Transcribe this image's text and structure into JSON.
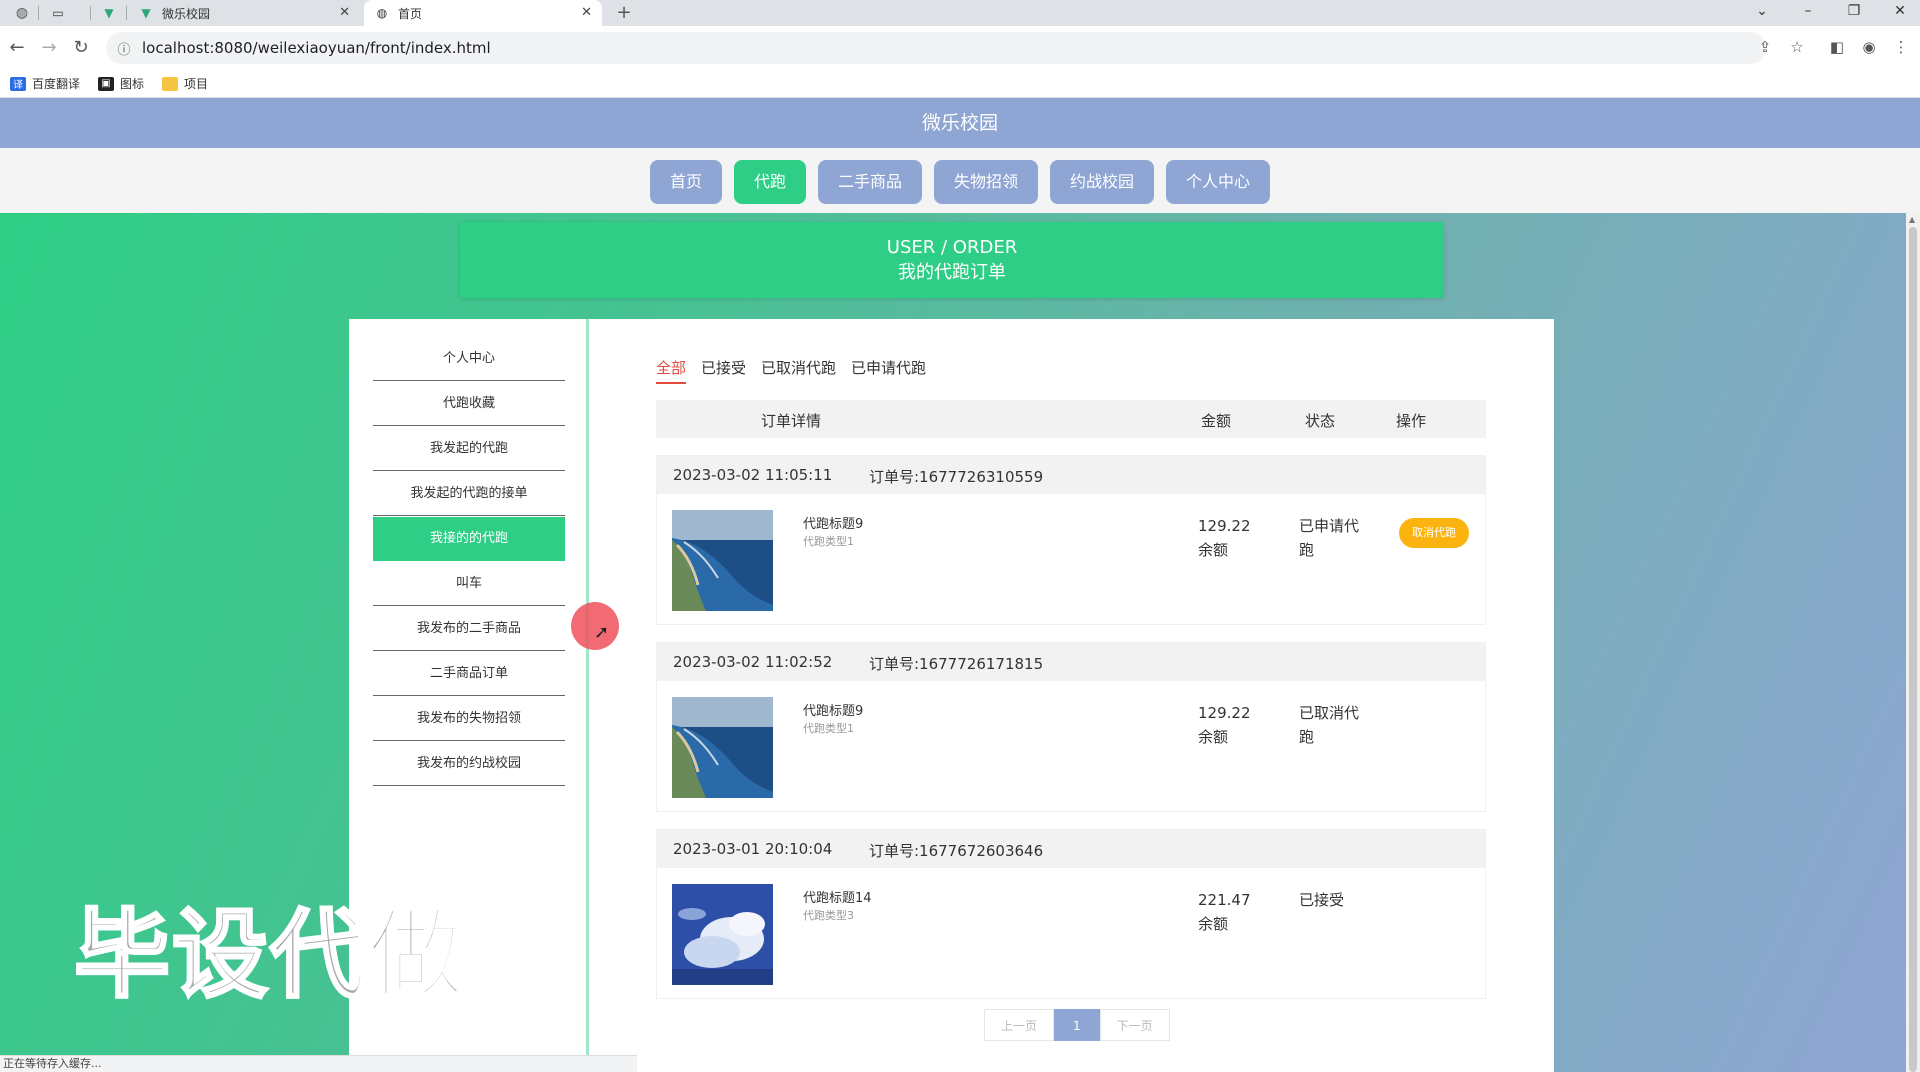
{
  "browser": {
    "tabs": [
      {
        "label": ""
      },
      {
        "label": ""
      },
      {
        "label": "微乐校园"
      },
      {
        "label": "首页"
      }
    ],
    "new_tab_icon": "+",
    "url": "localhost:8080/weilexiaoyuan/front/index.html",
    "bookmarks": [
      {
        "label": "百度翻译",
        "color": "#2b6de5"
      },
      {
        "label": "图标",
        "color": "#222222"
      },
      {
        "label": "项目",
        "color": "#f5c542"
      }
    ],
    "status_text": "正在等待存入缓存..."
  },
  "site": {
    "title": "微乐校园",
    "nav": [
      {
        "label": "首页",
        "active": false
      },
      {
        "label": "代跑",
        "active": true
      },
      {
        "label": "二手商品",
        "active": false
      },
      {
        "label": "失物招领",
        "active": false
      },
      {
        "label": "约战校园",
        "active": false
      },
      {
        "label": "个人中心",
        "active": false
      }
    ],
    "banner": {
      "en": "USER / ORDER",
      "cn": "我的代跑订单"
    },
    "accent_color": "#2ece86",
    "secondary_color": "#8fa5d3"
  },
  "sidebar": {
    "items": [
      {
        "label": "个人中心"
      },
      {
        "label": "代跑收藏"
      },
      {
        "label": "我发起的代跑"
      },
      {
        "label": "我发起的代跑的接单"
      },
      {
        "label": "我接的的代跑",
        "active": true
      },
      {
        "label": "叫车"
      },
      {
        "label": "我发布的二手商品"
      },
      {
        "label": "二手商品订单"
      },
      {
        "label": "我发布的失物招领"
      },
      {
        "label": "我发布的约战校园"
      }
    ]
  },
  "orders": {
    "tabs": [
      {
        "label": "全部",
        "active": true
      },
      {
        "label": "已接受"
      },
      {
        "label": "已取消代跑"
      },
      {
        "label": "已申请代跑"
      }
    ],
    "columns": {
      "detail": "订单详情",
      "amount": "金额",
      "status": "状态",
      "action": "操作"
    },
    "list": [
      {
        "time": "2023-03-02 11:05:11",
        "number": "订单号:1677726310559",
        "title": "代跑标题9",
        "type": "代跑类型1",
        "amount": "129.22",
        "pay": "余额",
        "status": "已申请代跑",
        "action": "取消代跑"
      },
      {
        "time": "2023-03-02 11:02:52",
        "number": "订单号:1677726171815",
        "title": "代跑标题9",
        "type": "代跑类型1",
        "amount": "129.22",
        "pay": "余额",
        "status": "已取消代跑",
        "action": ""
      },
      {
        "time": "2023-03-01 20:10:04",
        "number": "订单号:1677672603646",
        "title": "代跑标题14",
        "type": "代跑类型3",
        "amount": "221.47",
        "pay": "余额",
        "status": "已接受",
        "action": ""
      }
    ],
    "pager": {
      "prev": "上一页",
      "current": "1",
      "next": "下一页"
    }
  },
  "overlay": {
    "watermark": "毕设代做"
  }
}
